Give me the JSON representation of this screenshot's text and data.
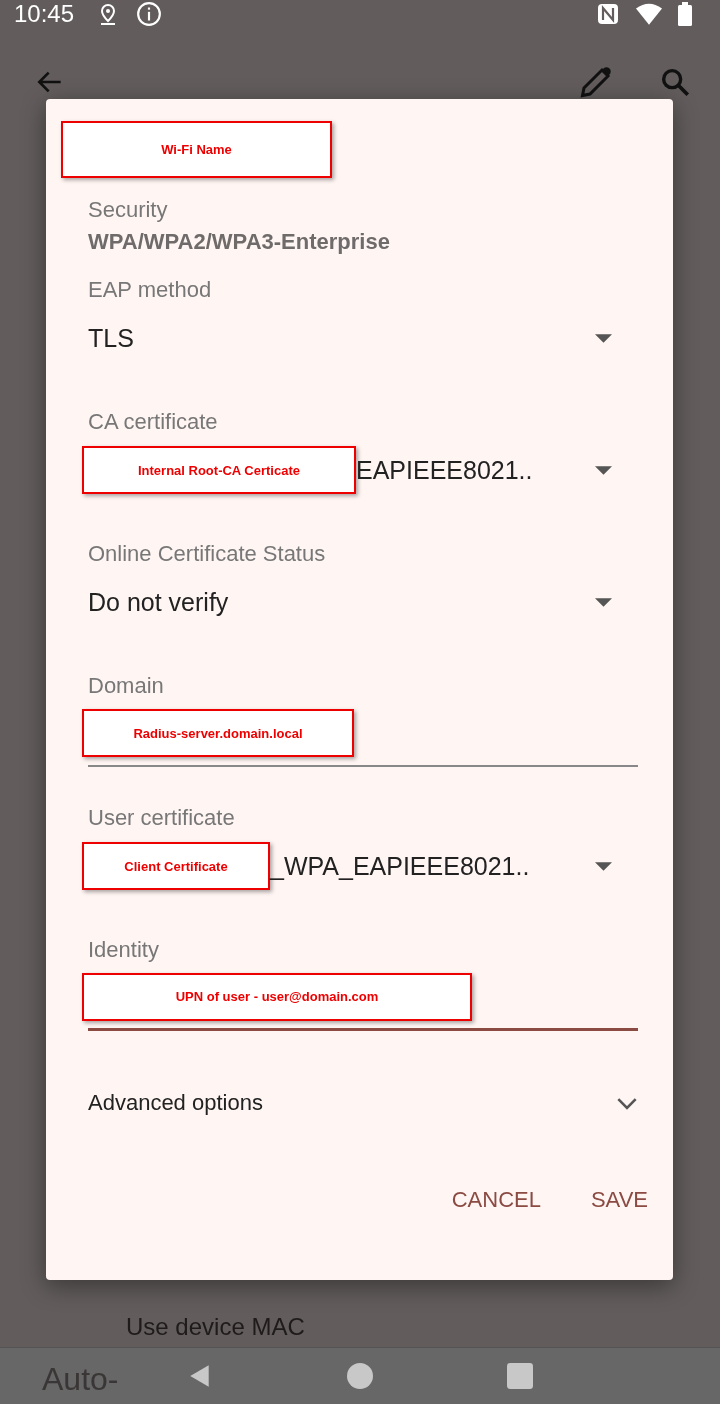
{
  "status_bar": {
    "time": "10:45"
  },
  "dialog": {
    "annotation_title": "Wi-Fi Name",
    "security": {
      "label": "Security",
      "value": "WPA/WPA2/WPA3-Enterprise"
    },
    "fields": [
      {
        "kind": "dropdown",
        "label": "EAP method",
        "value": "TLS"
      },
      {
        "kind": "dropdown",
        "label": "CA certificate",
        "annotation": "Internal Root-CA Certicate",
        "value": "EAPIEEE8021.."
      },
      {
        "kind": "dropdown",
        "label": "Online Certificate Status",
        "value": "Do not verify"
      },
      {
        "kind": "text",
        "label": "Domain",
        "annotation": "Radius-server.domain.local",
        "focused": false
      },
      {
        "kind": "dropdown",
        "label": "User certificate",
        "annotation": "Client Certificate",
        "value": "_WPA_EAPIEEE8021.."
      },
      {
        "kind": "text",
        "label": "Identity",
        "annotation": "UPN of user - user@domain.com",
        "focused": true
      }
    ],
    "advanced": {
      "label": "Advanced options",
      "expanded": false
    },
    "buttons": [
      {
        "label": "CANCEL"
      },
      {
        "label": "SAVE"
      }
    ]
  },
  "background": {
    "items": [
      "Use device MAC",
      "Auto-"
    ]
  }
}
